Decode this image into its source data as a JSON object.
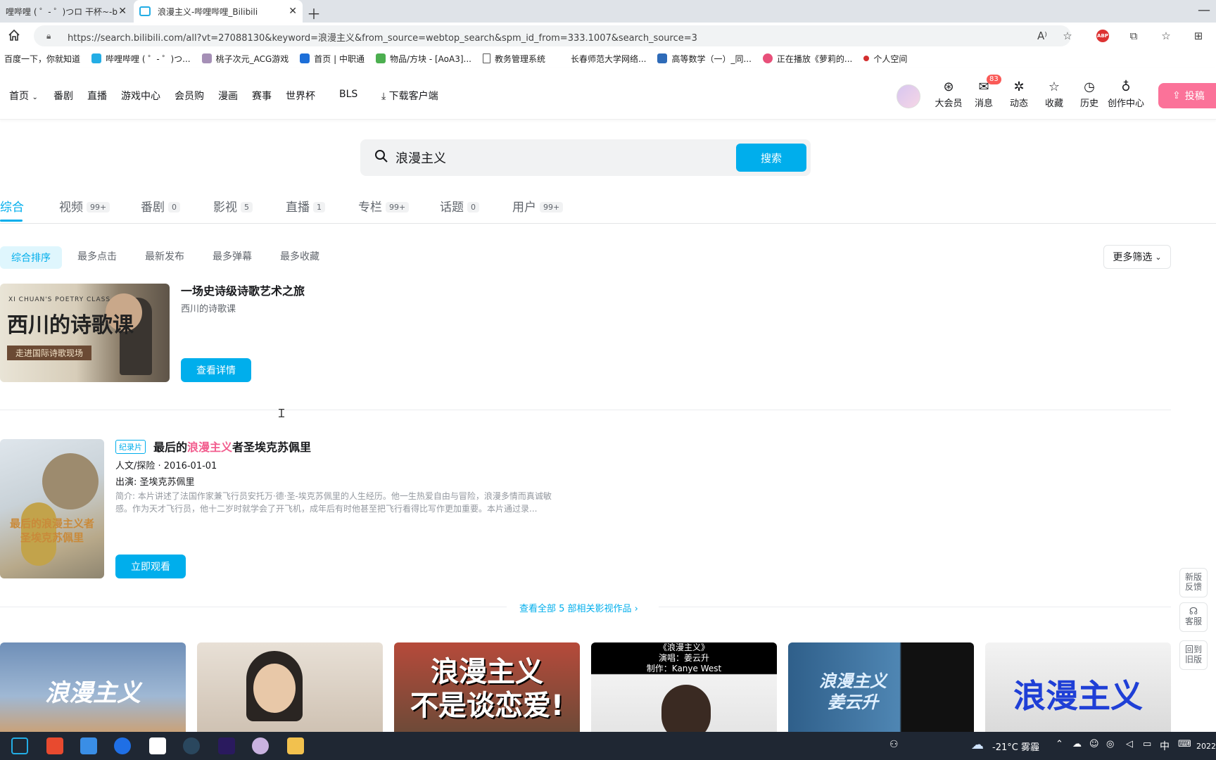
{
  "browser": {
    "tabs": [
      {
        "title": "哩哔哩 ( ゜- ゜)つロ 干杯~-bilibi"
      },
      {
        "title": "浪漫主义-哔哩哔哩_Bilibili"
      }
    ],
    "url": "https://search.bilibili.com/all?vt=27088130&keyword=浪漫主义&from_source=webtop_search&spm_id_from=333.1007&search_source=3",
    "bookmarks": [
      {
        "label": "百度一下，你就知道",
        "color": "#ffffff"
      },
      {
        "label": "哔哩哔哩 ( ゜- ゜)つ...",
        "color": "#23ade5"
      },
      {
        "label": "桃子次元_ACG游戏",
        "color": "#a58fb6"
      },
      {
        "label": "首页 | 中职通",
        "color": "#1d6fd8"
      },
      {
        "label": "物品/方块 - [AoA3]...",
        "color": "#4caf50"
      },
      {
        "label": "教务管理系统",
        "color": "#ffffff"
      },
      {
        "label": "长春师范大学网络...",
        "color": "#ffffff"
      },
      {
        "label": "高等数学（一）_同...",
        "color": "#2e6bb8"
      },
      {
        "label": "正在播放《萝莉的...",
        "color": "#e8507a"
      },
      {
        "label": "个人空间",
        "color": "#d32f2f"
      }
    ]
  },
  "header": {
    "nav": [
      "首页",
      "番剧",
      "直播",
      "游戏中心",
      "会员购",
      "漫画",
      "赛事",
      "世界杯",
      "BLS",
      "下载客户端"
    ],
    "icons": [
      {
        "label": "大会员",
        "icon": "vip-icon",
        "glyph": "⊛"
      },
      {
        "label": "消息",
        "icon": "message-icon",
        "glyph": "✉",
        "badge": "83"
      },
      {
        "label": "动态",
        "icon": "dynamic-icon",
        "glyph": "✲"
      },
      {
        "label": "收藏",
        "icon": "star-icon",
        "glyph": "☆"
      },
      {
        "label": "历史",
        "icon": "history-icon",
        "glyph": "◷"
      },
      {
        "label": "创作中心",
        "icon": "bulb-icon",
        "glyph": "♁"
      }
    ],
    "upload_label": "投稿"
  },
  "search": {
    "query": "浪漫主义",
    "button": "搜索"
  },
  "categories": [
    {
      "label": "综合",
      "count": ""
    },
    {
      "label": "视频",
      "count": "99+"
    },
    {
      "label": "番剧",
      "count": "0"
    },
    {
      "label": "影视",
      "count": "5"
    },
    {
      "label": "直播",
      "count": "1"
    },
    {
      "label": "专栏",
      "count": "99+"
    },
    {
      "label": "话题",
      "count": "0"
    },
    {
      "label": "用户",
      "count": "99+"
    }
  ],
  "sort": {
    "options": [
      "综合排序",
      "最多点击",
      "最新发布",
      "最多弹幕",
      "最多收藏"
    ],
    "more": "更多筛选"
  },
  "result1": {
    "thumb_top": "XI CHUAN'S POETRY CLASS",
    "thumb_title": "西川的诗歌课",
    "thumb_banner": "走进国际诗歌现场",
    "title": "一场史诗级诗歌艺术之旅",
    "subtitle": "西川的诗歌课",
    "button": "查看详情"
  },
  "result2": {
    "tag": "纪录片",
    "title_pre": "最后的",
    "title_hl": "浪漫主义",
    "title_post": "者圣埃克苏佩里",
    "meta": "人文/探险 · 2016-01-01",
    "cast": "出演:  圣埃克苏佩里",
    "desc": "简介:  本片讲述了法国作家兼飞行员安托万·德·圣-埃克苏佩里的人生经历。他一生热爱自由与冒险，浪漫多情而真诚敏感。作为天才飞行员，他十二岁时就学会了开飞机，成年后有时他甚至把飞行看得比写作更加重要。本片通过录...",
    "thumb_text": "最后的浪漫主义者\n圣埃克苏佩里",
    "button": "立即观看"
  },
  "view_all": "查看全部 5 部相关影视作品 ›",
  "video_cards": [
    {
      "text": "浪漫主义",
      "bg": "linear-gradient(180deg,#6f8fb8 0%,#9fb8d4 60%,#c9a27a 100%)",
      "color": "#ffffff"
    },
    {
      "text": "",
      "bg": "linear-gradient(180deg,#e8e0d6 0%,#cfc2b3 100%)",
      "color": "#ffffff"
    },
    {
      "text": "浪漫主义\n不是谈恋爱!",
      "bg": "linear-gradient(180deg,#b64a3a 0%,#6e4a38 100%)",
      "color": "#ffffff"
    },
    {
      "text": "《浪漫主义》\n演唱：姜云升\n制作：Kanye West",
      "bg": "linear-gradient(180deg,#000000 0%,#000000 35%,#f2f2f2 36%,#e5e5e5 100%)",
      "color": "#ffffff"
    },
    {
      "text": "浪漫主义\n姜云升",
      "bg": "linear-gradient(90deg,#2f5f8a 0%,#4f86b3 60%,#111 61%,#111 100%)",
      "color": "#e0f0ff"
    },
    {
      "text": "浪漫主义",
      "bg": "linear-gradient(180deg,#f3f3f3 0%,#dadada 100%)",
      "color": "#1f3fd6"
    }
  ],
  "side": {
    "feedback": "新版\n反馈",
    "service": "客服",
    "old": "回到\n旧版"
  },
  "taskbar": {
    "weather": "-21°C  雾霾",
    "ime": "中",
    "year": "2022"
  }
}
